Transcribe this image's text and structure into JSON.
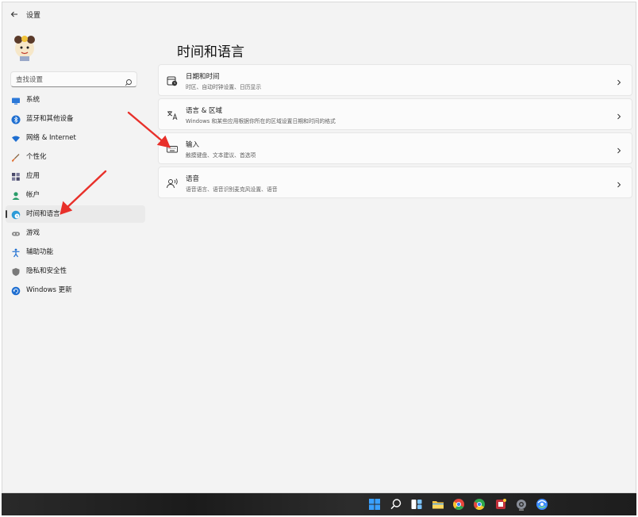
{
  "window": {
    "title": "设置",
    "back_icon": "back-arrow-icon"
  },
  "sidebar": {
    "search_placeholder": "查找设置",
    "items": [
      {
        "label": "系统",
        "icon": "monitor-icon",
        "color": "#2b78d8"
      },
      {
        "label": "蓝牙和其他设备",
        "icon": "bluetooth-icon",
        "color": "#1f6fd1"
      },
      {
        "label": "网络 & Internet",
        "icon": "wifi-icon",
        "color": "#1f6fd1"
      },
      {
        "label": "个性化",
        "icon": "brush-icon",
        "color": "#e06a2a"
      },
      {
        "label": "应用",
        "icon": "apps-icon",
        "color": "#4a4a6a"
      },
      {
        "label": "帐户",
        "icon": "person-icon",
        "color": "#2a9d6a"
      },
      {
        "label": "时间和语言",
        "icon": "globe-clock-icon",
        "color": "#2b9bd8",
        "active": true
      },
      {
        "label": "游戏",
        "icon": "gamepad-icon",
        "color": "#7a7a7a"
      },
      {
        "label": "辅助功能",
        "icon": "accessibility-icon",
        "color": "#1f6fd1"
      },
      {
        "label": "隐私和安全性",
        "icon": "shield-icon",
        "color": "#7a7a7a"
      },
      {
        "label": "Windows 更新",
        "icon": "update-icon",
        "color": "#1f6fd1"
      }
    ]
  },
  "main": {
    "title": "时间和语言",
    "cards": [
      {
        "title": "日期和时间",
        "subtitle": "时区、自动时钟设置、日历显示",
        "icon": "calendar-clock-icon"
      },
      {
        "title": "语言 & 区域",
        "subtitle": "Windows 和某些应用根据你所在的区域设置日期和时间的格式",
        "icon": "language-icon"
      },
      {
        "title": "输入",
        "subtitle": "触摸键盘、文本建议、首选项",
        "icon": "keyboard-icon"
      },
      {
        "title": "语音",
        "subtitle": "语音语言、语音识别麦克风设置、语音",
        "icon": "speech-icon"
      }
    ]
  },
  "taskbar": {
    "icons": [
      "start-icon",
      "search-icon",
      "task-view-icon",
      "file-explorer-icon",
      "chrome-icon",
      "chrome-beta-icon",
      "app-store-icon",
      "settings-icon",
      "browser-icon"
    ]
  },
  "colors": {
    "accent": "#2b78d8",
    "annotation_arrow": "#e8302a"
  }
}
